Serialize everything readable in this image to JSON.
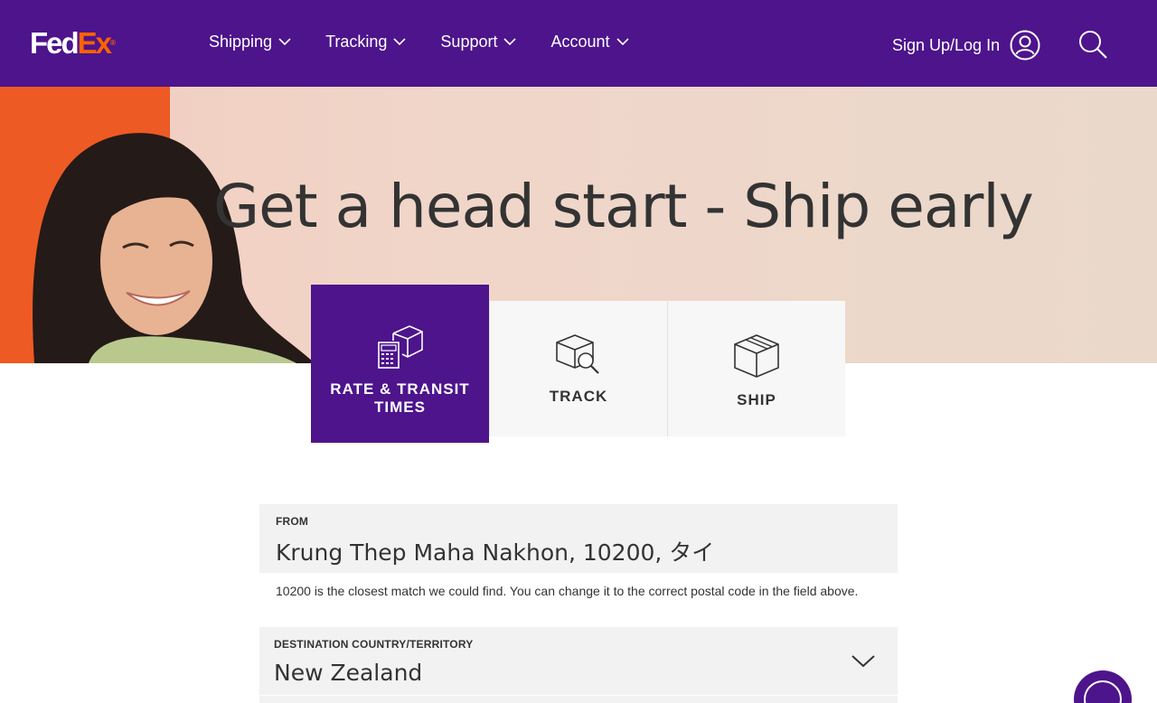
{
  "header": {
    "logo": {
      "fed": "Fed",
      "ex": "Ex",
      "reg": "®"
    },
    "nav": [
      {
        "label": "Shipping"
      },
      {
        "label": "Tracking"
      },
      {
        "label": "Support"
      },
      {
        "label": "Account"
      }
    ],
    "signin_label": "Sign Up/Log In",
    "icons": {
      "user": "user-circle-icon",
      "search": "search-icon",
      "dropdown": "chevron-down-icon"
    }
  },
  "hero": {
    "title": "Get a head start - Ship early"
  },
  "tiles": [
    {
      "label": "RATE & TRANSIT TIMES",
      "icon": "calculator-box-icon",
      "active": true
    },
    {
      "label": "TRACK",
      "icon": "box-magnifier-icon",
      "active": false
    },
    {
      "label": "SHIP",
      "icon": "package-icon",
      "active": false
    }
  ],
  "form": {
    "from": {
      "label": "FROM",
      "value": "Krung Thep Maha Nakhon, 10200, タイ"
    },
    "hint": "10200 is the closest match we could find. You can change it to the correct postal code in the field above.",
    "destination": {
      "label": "DESTINATION COUNTRY/TERRITORY",
      "value": "New Zealand"
    }
  },
  "colors": {
    "brand_purple": "#4d148c",
    "brand_orange": "#ff6200",
    "field_bg": "#f2f2f2"
  }
}
